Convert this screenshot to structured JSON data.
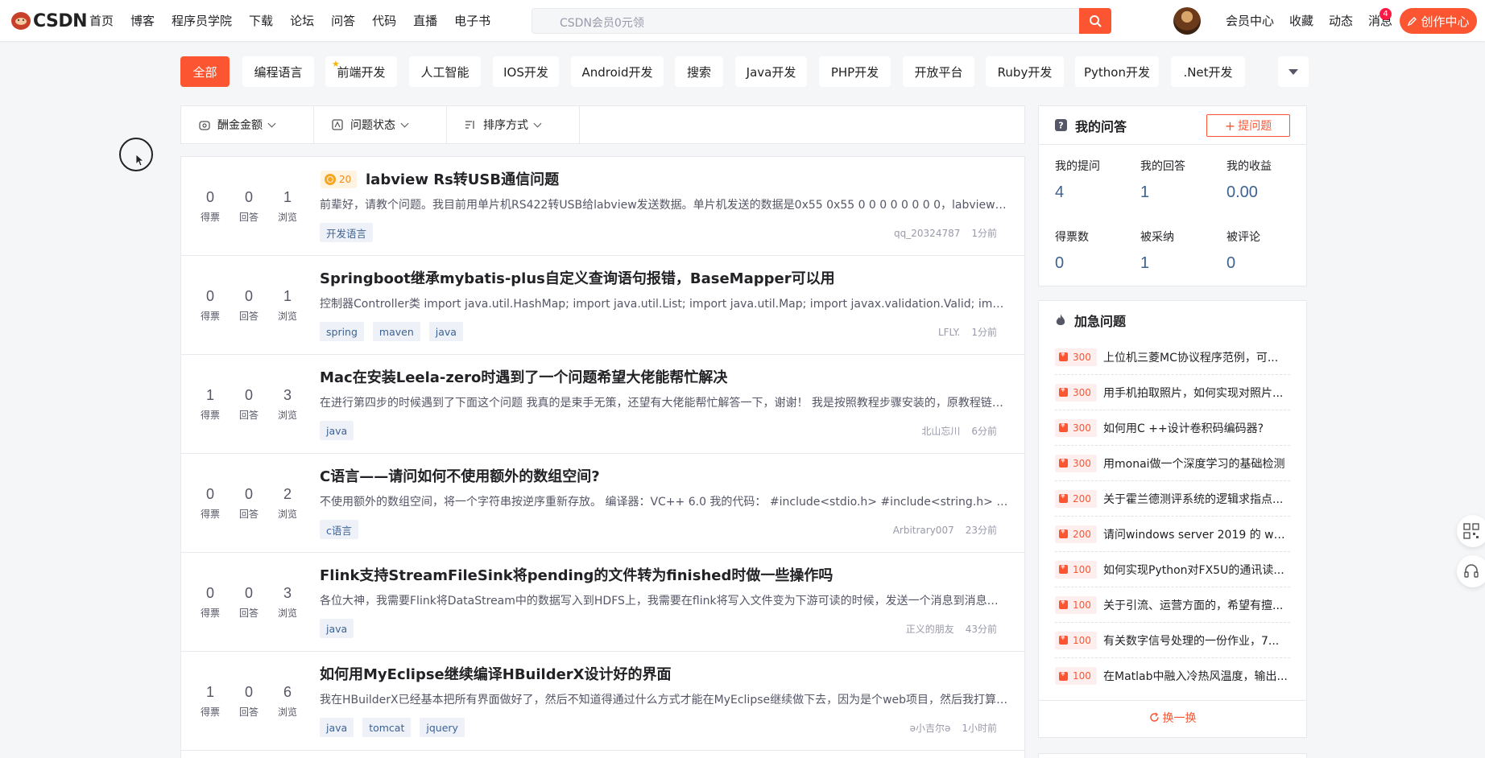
{
  "brand": {
    "logo_text": "CSDN",
    "accent": "#fc5531",
    "link_color": "#3d6294"
  },
  "nav": [
    "首页",
    "博客",
    "程序员学院",
    "下载",
    "论坛",
    "问答",
    "代码",
    "直播",
    "电子书"
  ],
  "search": {
    "placeholder": "CSDN会员0元领"
  },
  "right_nav": [
    "会员中心",
    "收藏",
    "动态",
    "消息"
  ],
  "message_badge": "4",
  "create_label": "创作中心",
  "categories": [
    "全部",
    "编程语言",
    "前端开发",
    "人工智能",
    "IOS开发",
    "Android开发",
    "搜索",
    "Java开发",
    "PHP开发",
    "开放平台",
    "Ruby开发",
    "Python开发",
    ".Net开发"
  ],
  "filters": [
    "酬金金额",
    "问题状态",
    "排序方式"
  ],
  "stat_labels": [
    "得票",
    "回答",
    "浏览"
  ],
  "questions": [
    {
      "votes": "0",
      "answers": "0",
      "views": "1",
      "reward": "20",
      "title": "labview Rs转USB通信问题",
      "desc": "前辈好，请教个问题。我目前用单片机RS422转USB给labview发送数据。单片机发送的数据是0x55 0x55 0 0 0 0 0 0 0 0，labview接收到的数据时好时坏，不知道是什么原因",
      "tags": [
        "开发语言"
      ],
      "author": "qq_20324787",
      "time": "1分前"
    },
    {
      "votes": "0",
      "answers": "0",
      "views": "1",
      "reward": "",
      "title": "Springboot继承mybatis-plus自定义查询语句报错，BaseMapper可以用",
      "desc": "控制器Controller类 import java.util.HashMap; import java.util.List; import java.util.Map; import javax.validation.Valid; import org.springframework",
      "tags": [
        "spring",
        "maven",
        "java"
      ],
      "author": "LFLY.",
      "time": "1分前"
    },
    {
      "votes": "1",
      "answers": "0",
      "views": "3",
      "reward": "",
      "title": "Mac在安装Leela-zero时遇到了一个问题希望大佬能帮忙解决",
      "desc": "在进行第四步的时候遇到了下面这个问题 我真的是束手无策，还望有大佬能帮忙解答一下，谢谢！ 我是按照教程步骤安装的，原教程链接如下",
      "tags": [
        "java"
      ],
      "author": "北山忘川",
      "time": "6分前"
    },
    {
      "votes": "0",
      "answers": "0",
      "views": "2",
      "reward": "",
      "title": "C语言——请问如何不使用额外的数组空间?",
      "desc": "不使用额外的数组空间，将一个字符串按逆序重新存放。 编译器：VC++ 6.0 我的代码： #include<stdio.h> #include<string.h> void main()",
      "tags": [
        "c语言"
      ],
      "author": "Arbitrary007",
      "time": "23分前"
    },
    {
      "votes": "0",
      "answers": "0",
      "views": "3",
      "reward": "",
      "title": "Flink支持StreamFileSink将pending的文件转为finished时做一些操作吗",
      "desc": "各位大神，我需要Flink将DataStream中的数据写入到HDFS上，我需要在flink将写入文件变为下游可读的时候，发送一个消息到消息队列中",
      "tags": [
        "java"
      ],
      "author": "正义的朋友",
      "time": "43分前"
    },
    {
      "votes": "1",
      "answers": "0",
      "views": "6",
      "reward": "",
      "title": "如何用MyEclipse继续编译HBuilderX设计好的界面",
      "desc": "我在HBuilderX已经基本把所有界面做好了，然后不知道得通过什么方式才能在MyEclipse继续做下去，因为是个web项目，然后我打算用java写后端",
      "tags": [
        "java",
        "tomcat",
        "jquery"
      ],
      "author": "ə小吉尔ə",
      "time": "1小时前"
    }
  ],
  "my_qa": {
    "title": "我的问答",
    "ask_label": "提问题",
    "stats": [
      {
        "label": "我的提问",
        "value": "4"
      },
      {
        "label": "我的回答",
        "value": "1"
      },
      {
        "label": "我的收益",
        "value": "0.00"
      },
      {
        "label": "得票数",
        "value": "0"
      },
      {
        "label": "被采纳",
        "value": "1"
      },
      {
        "label": "被评论",
        "value": "0"
      }
    ]
  },
  "urgent": {
    "title": "加急问题",
    "items": [
      {
        "amount": "300",
        "title": "上位机三菱MC协议程序范例，可..."
      },
      {
        "amount": "300",
        "title": "用手机拍取照片，如何实现对照片..."
      },
      {
        "amount": "300",
        "title": "如何用C ++设计卷积码编码器?"
      },
      {
        "amount": "300",
        "title": "用monai做一个深度学习的基础检测"
      },
      {
        "amount": "200",
        "title": "关于霍兰德测评系统的逻辑求指点..."
      },
      {
        "amount": "200",
        "title": "请问windows server 2019 的 web..."
      },
      {
        "amount": "100",
        "title": "如何实现Python对FX5U的通讯读..."
      },
      {
        "amount": "100",
        "title": "关于引流、运营方面的，希望有擅..."
      },
      {
        "amount": "100",
        "title": "有关数字信号处理的一份作业，7..."
      },
      {
        "amount": "100",
        "title": "在Matlab中融入冷热风温度，输出..."
      }
    ],
    "refresh_label": "换一换"
  }
}
